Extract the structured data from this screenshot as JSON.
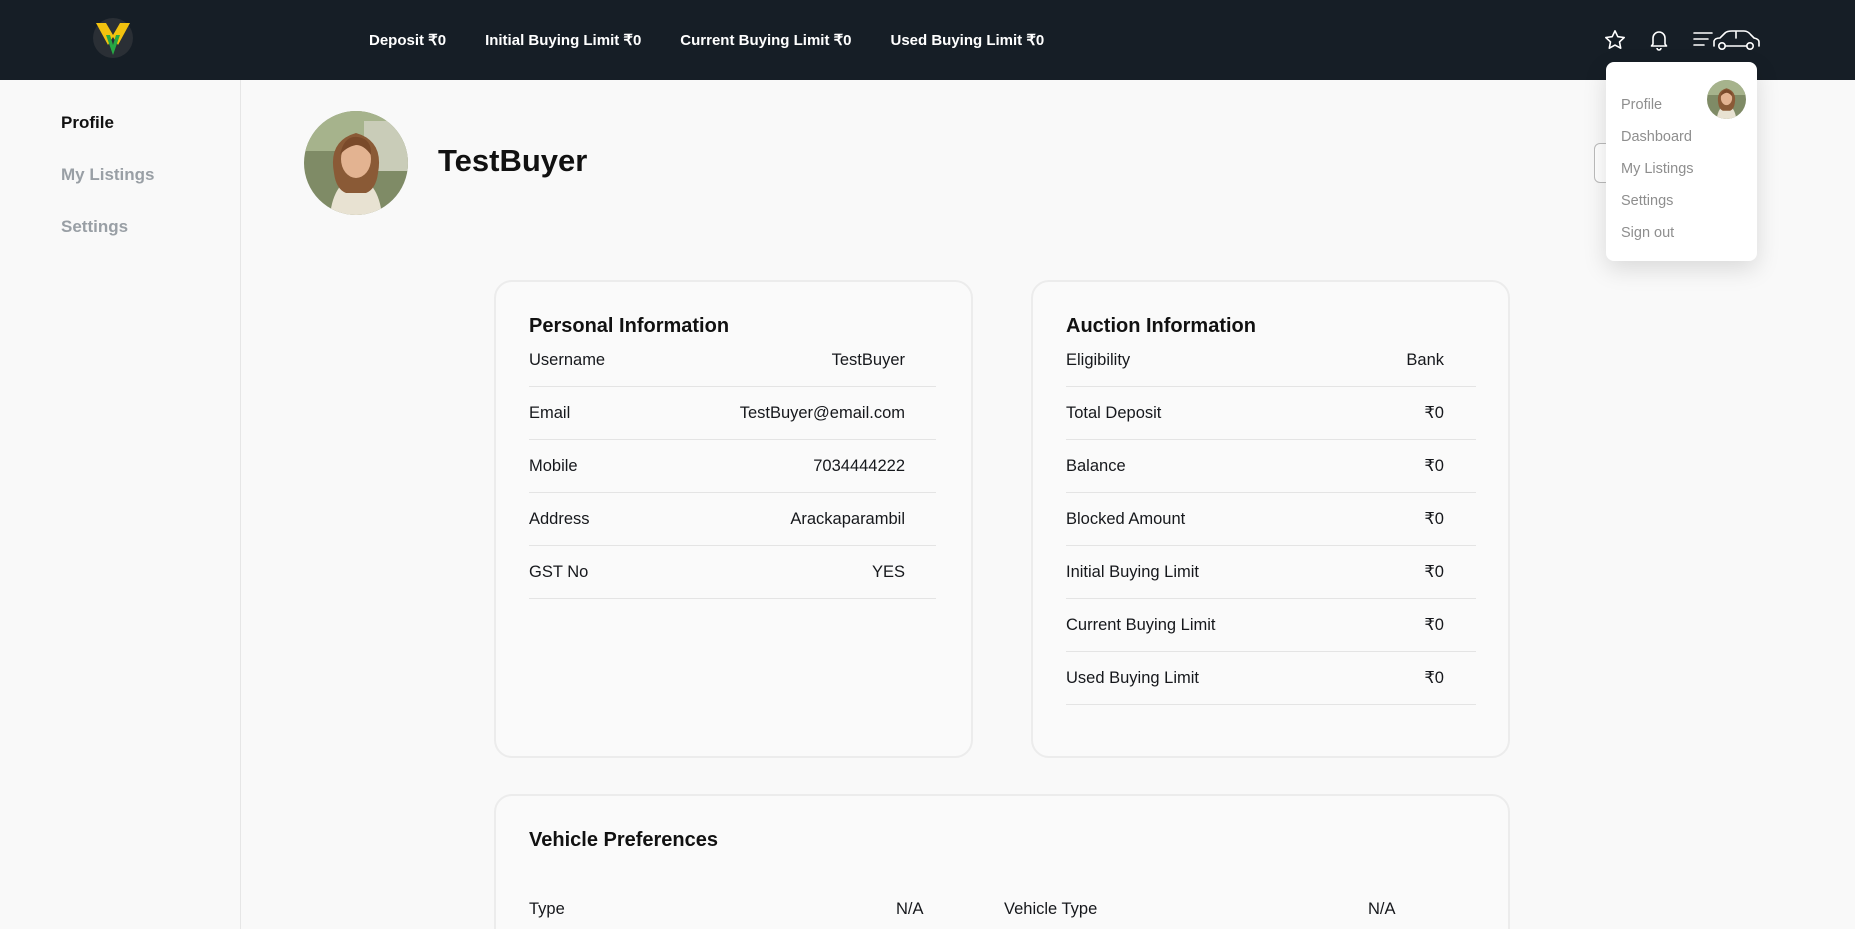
{
  "topbar": {
    "stats": [
      "Deposit ₹0",
      "Initial Buying Limit ₹0",
      "Current Buying Limit ₹0",
      "Used Buying Limit ₹0"
    ]
  },
  "sidebar": {
    "items": [
      "Profile",
      "My Listings",
      "Settings"
    ]
  },
  "profile": {
    "name": "TestBuyer"
  },
  "personal": {
    "title": "Personal Information",
    "rows": [
      {
        "label": "Username",
        "value": "TestBuyer"
      },
      {
        "label": "Email",
        "value": "TestBuyer@email.com"
      },
      {
        "label": "Mobile",
        "value": "7034444222"
      },
      {
        "label": "Address",
        "value": "Arackaparambil"
      },
      {
        "label": "GST No",
        "value": "YES"
      }
    ]
  },
  "auction": {
    "title": "Auction Information",
    "rows": [
      {
        "label": "Eligibility",
        "value": "Bank"
      },
      {
        "label": "Total Deposit",
        "value": "₹0"
      },
      {
        "label": "Balance",
        "value": "₹0"
      },
      {
        "label": "Blocked Amount",
        "value": "₹0"
      },
      {
        "label": "Initial Buying Limit",
        "value": "₹0"
      },
      {
        "label": "Current Buying Limit",
        "value": "₹0"
      },
      {
        "label": "Used Buying Limit",
        "value": "₹0"
      }
    ]
  },
  "vehicle_prefs": {
    "title": "Vehicle Preferences",
    "type_label": "Type",
    "type_value": "N/A",
    "vehicle_type_label": "Vehicle Type",
    "vehicle_type_value": "N/A"
  },
  "dropdown": {
    "items": [
      "Profile",
      "Dashboard",
      "My Listings",
      "Settings",
      "Sign out"
    ]
  },
  "icons": {
    "logo": "brand-logo",
    "favorites": "star-icon",
    "notifications": "bell-icon",
    "menu": "menu-car-icon"
  },
  "colors": {
    "topbar": "#161e26",
    "logo_yellow": "#f2c20f",
    "logo_green": "#27a844",
    "muted_text": "#999fa5"
  }
}
